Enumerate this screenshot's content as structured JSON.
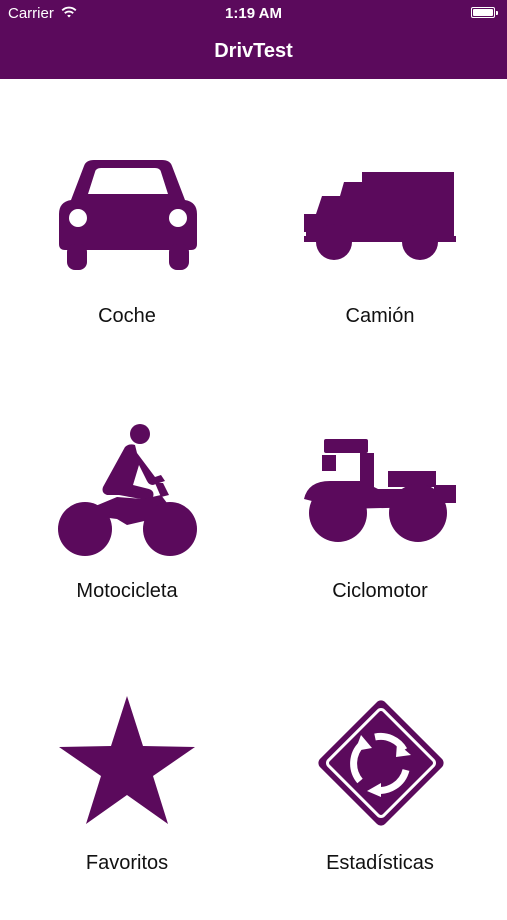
{
  "status_bar": {
    "carrier": "Carrier",
    "time": "1:19 AM"
  },
  "nav": {
    "title": "DrivTest"
  },
  "colors": {
    "brand": "#5b0a5c",
    "background": "#ffffff",
    "label_text": "#111111"
  },
  "menu": [
    {
      "label": "Coche",
      "icon": "car-icon"
    },
    {
      "label": "Camión",
      "icon": "truck-icon"
    },
    {
      "label": "Motocicleta",
      "icon": "motorcycle-icon"
    },
    {
      "label": "Ciclomotor",
      "icon": "moped-icon"
    },
    {
      "label": "Favoritos",
      "icon": "star-icon"
    },
    {
      "label": "Estadísticas",
      "icon": "roundabout-sign-icon"
    }
  ]
}
